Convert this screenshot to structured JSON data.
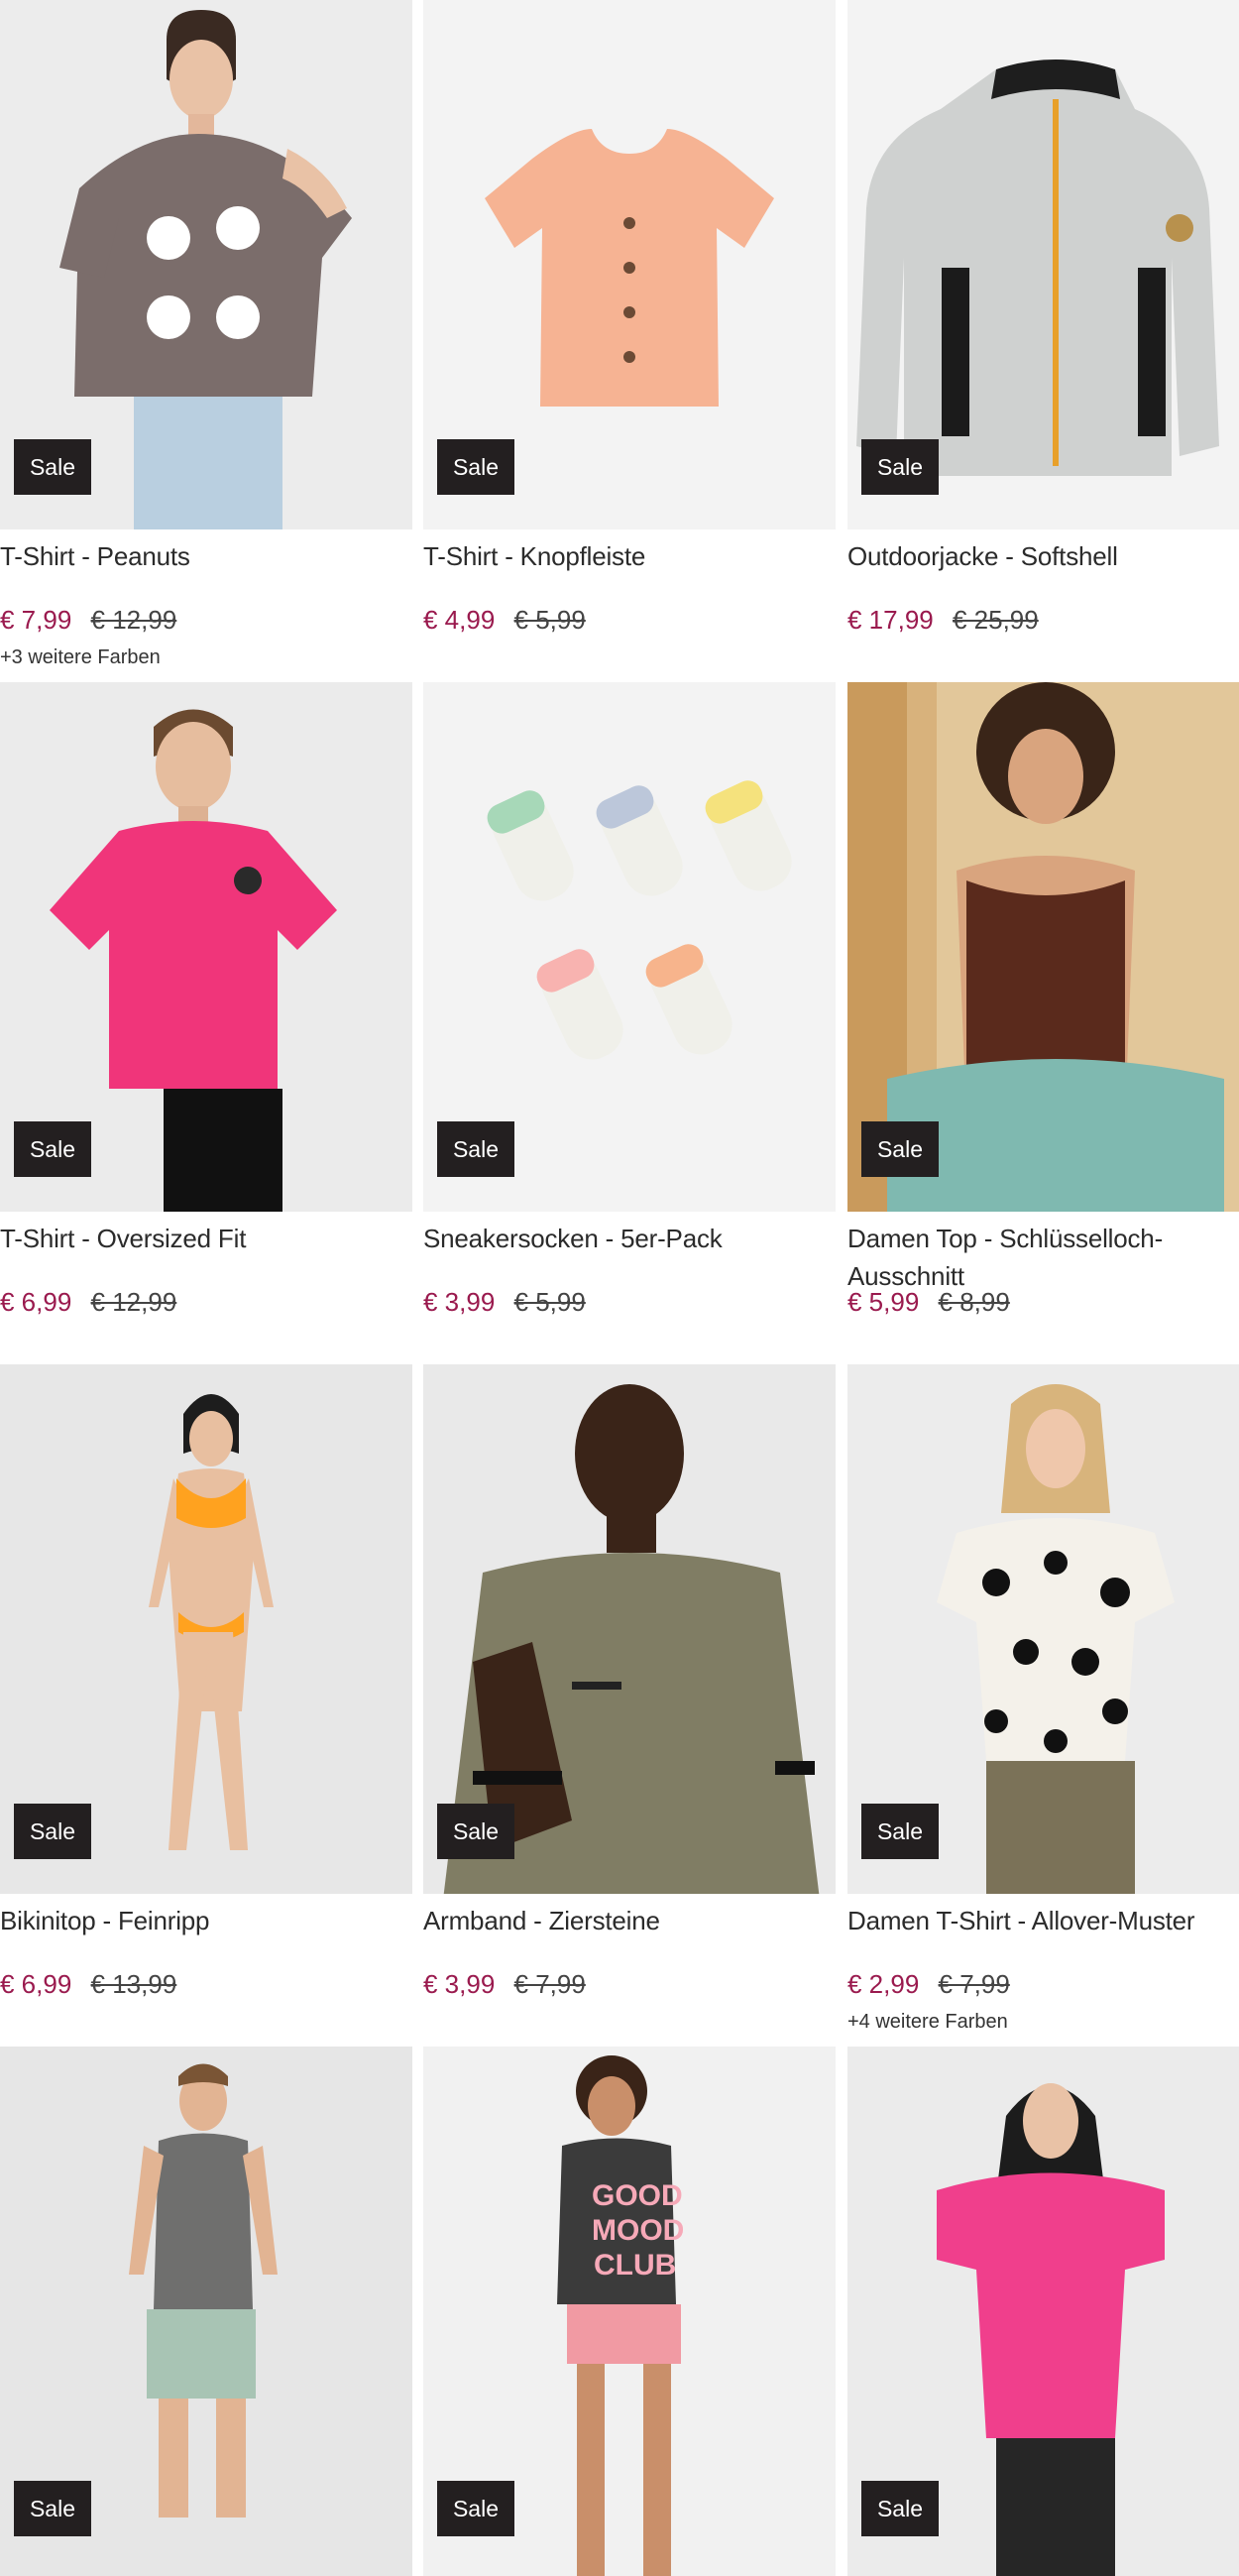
{
  "sale_label": "Sale",
  "colors": {
    "price": "#9a1a4e",
    "badge_bg": "#231f20"
  },
  "products": [
    {
      "title": "T-Shirt - Peanuts",
      "price": "€ 7,99",
      "old_price": "€ 12,99",
      "more_colors": "+3 weitere Farben",
      "image": "woman-grey-snoopy-tshirt"
    },
    {
      "title": "T-Shirt - Knopfleiste",
      "price": "€ 4,99",
      "old_price": "€ 5,99",
      "more_colors": "",
      "image": "peach-button-tshirt"
    },
    {
      "title": "Outdoorjacke - Softshell",
      "price": "€ 17,99",
      "old_price": "€ 25,99",
      "more_colors": "",
      "image": "grey-softshell-jacket"
    },
    {
      "title": "T-Shirt - Oversized Fit",
      "price": "€ 6,99",
      "old_price": "€ 12,99",
      "more_colors": "",
      "image": "man-pink-tshirt"
    },
    {
      "title": "Sneakersocken - 5er-Pack",
      "price": "€ 3,99",
      "old_price": "€ 5,99",
      "more_colors": "",
      "image": "five-pastel-socks"
    },
    {
      "title": "Damen Top - Schlüsselloch-Ausschnitt",
      "price": "€ 5,99",
      "old_price": "€ 8,99",
      "more_colors": "",
      "image": "woman-brown-top"
    },
    {
      "title": "Bikinitop - Feinripp",
      "price": "€ 6,99",
      "old_price": "€ 13,99",
      "more_colors": "",
      "image": "woman-orange-bikini"
    },
    {
      "title": "Armband - Ziersteine",
      "price": "€ 3,99",
      "old_price": "€ 7,99",
      "more_colors": "",
      "image": "man-olive-tshirt-bracelet"
    },
    {
      "title": "Damen T-Shirt - Allover-Muster",
      "price": "€ 2,99",
      "old_price": "€ 7,99",
      "more_colors": "+4 weitere Farben",
      "image": "woman-leopard-tshirt"
    },
    {
      "title": "",
      "price": "",
      "old_price": "",
      "more_colors": "",
      "image": "man-grey-tanktop"
    },
    {
      "title": "",
      "price": "",
      "old_price": "",
      "more_colors": "",
      "image": "woman-good-mood-club-pyjama"
    },
    {
      "title": "",
      "price": "",
      "old_price": "",
      "more_colors": "",
      "image": "woman-pink-tshirt"
    }
  ],
  "graphic_text": {
    "good_mood": [
      "GOOD",
      "MOOD",
      "CLUB"
    ]
  }
}
